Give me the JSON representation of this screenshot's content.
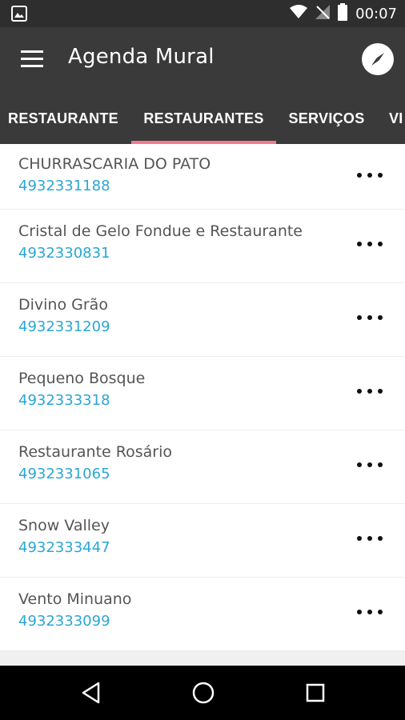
{
  "status_bar": {
    "time": "00:07",
    "icons": [
      "image-icon",
      "wifi-icon",
      "no-signal-icon",
      "battery-icon"
    ]
  },
  "app_bar": {
    "title": "Agenda Mural",
    "menu_icon": "hamburger-menu-icon",
    "action_icon": "compass-icon"
  },
  "tabs": [
    {
      "label": "RESTAURANTE",
      "active": false
    },
    {
      "label": "RESTAURANTES",
      "active": true
    },
    {
      "label": "SERVIÇOS",
      "active": false
    },
    {
      "label": "VI",
      "active": false
    }
  ],
  "listings": [
    {
      "name": "CHURRASCARIA DO PATO",
      "phone": "4932331188"
    },
    {
      "name": "Cristal de Gelo Fondue e Restaurante",
      "phone": "4932330831"
    },
    {
      "name": "Divino Grão",
      "phone": "4932331209"
    },
    {
      "name": "Pequeno Bosque",
      "phone": "4932333318"
    },
    {
      "name": "Restaurante Rosário",
      "phone": "4932331065"
    },
    {
      "name": "Snow Valley",
      "phone": "4932333447"
    },
    {
      "name": "Vento Minuano",
      "phone": "4932333099"
    }
  ],
  "colors": {
    "app_bar": "#3a3a3a",
    "status_bar": "#2e2e2e",
    "tab_indicator": "#f07a90",
    "phone_link": "#2aa6d6"
  },
  "nav_bar": {
    "icons": [
      "back-icon",
      "home-icon",
      "recents-icon"
    ]
  }
}
